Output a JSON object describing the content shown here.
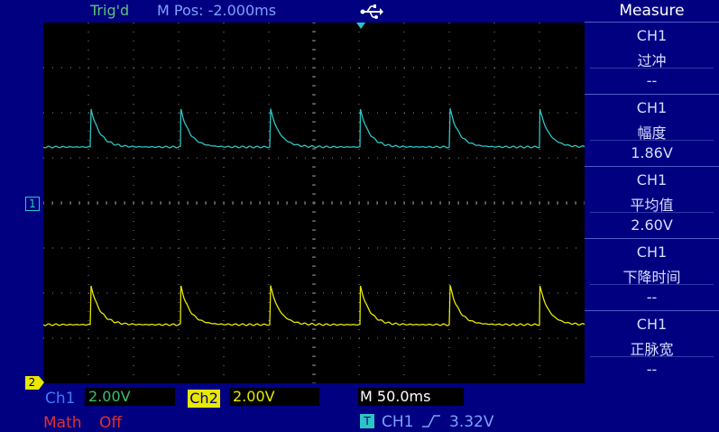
{
  "status": {
    "trigger_state": "Trig'd",
    "horizontal_position": "M Pos: -2.000ms",
    "usb_icon": "usb-icon"
  },
  "colors": {
    "ch1": "#2ec4c4",
    "ch2": "#e8e800",
    "background": "#000080",
    "math": "#e03030"
  },
  "markers": {
    "ch1_ground": "1",
    "ch2_ground": "2"
  },
  "measure_panel": {
    "title": "Measure",
    "items": [
      {
        "source": "CH1",
        "type": "过冲",
        "value": "--"
      },
      {
        "source": "CH1",
        "type": "幅度",
        "value": "1.86V"
      },
      {
        "source": "CH1",
        "type": "平均值",
        "value": "2.60V"
      },
      {
        "source": "CH1",
        "type": "下降时间",
        "value": "--"
      },
      {
        "source": "CH1",
        "type": "正脉宽",
        "value": "--"
      }
    ]
  },
  "bottom_bar": {
    "ch1_label": "Ch1",
    "ch1_scale": "2.00V",
    "ch2_label": "Ch2",
    "ch2_scale": "2.00V",
    "timebase": "M 50.0ms",
    "math_label": "Math",
    "math_state": "Off",
    "trigger_badge": "T",
    "trigger_source": "CH1",
    "trigger_edge_icon": "rising-edge-icon",
    "trigger_level": "3.32V"
  }
}
